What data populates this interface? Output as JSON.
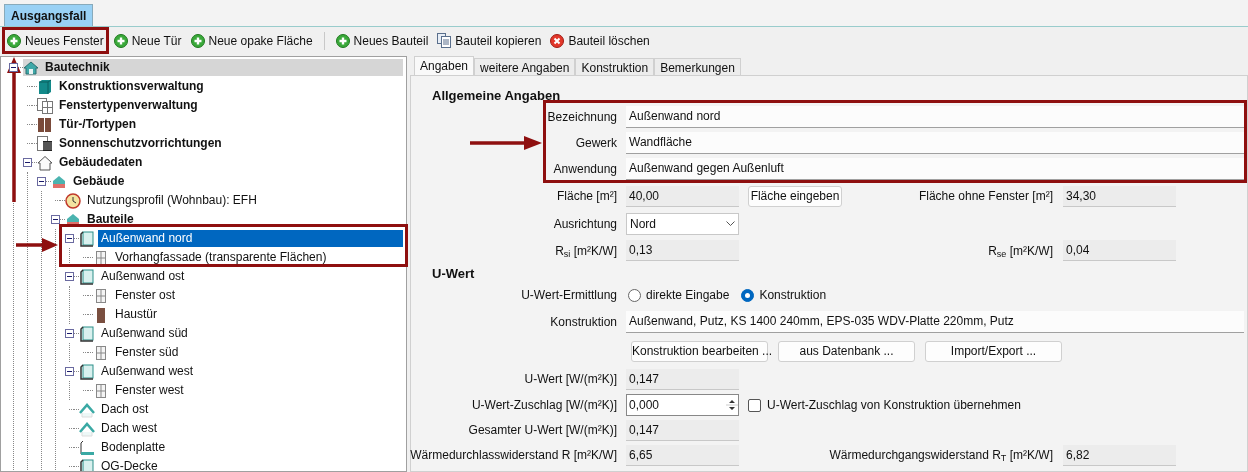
{
  "doc_tabs": [
    {
      "label": "Ausgangsfall",
      "selected": true
    }
  ],
  "toolbar": {
    "groups": [
      [
        {
          "label": "Neues Fenster",
          "kind": "add",
          "annotated": true
        },
        {
          "label": "Neue Tür",
          "kind": "add"
        },
        {
          "label": "Neue opake Fläche",
          "kind": "add"
        }
      ],
      [
        {
          "label": "Neues Bauteil",
          "kind": "add"
        },
        {
          "label": "Bauteil kopieren",
          "kind": "copy"
        },
        {
          "label": "Bauteil löschen",
          "kind": "delete"
        }
      ]
    ]
  },
  "tree": [
    {
      "label": "Bautechnik",
      "kind": "house",
      "bold": true,
      "selected": false,
      "expanded": true,
      "children": [
        {
          "label": "Konstruktionsverwaltung",
          "kind": "block",
          "bold": true,
          "selected": false
        },
        {
          "label": "Fenstertypenverwaltung",
          "kind": "window-type",
          "bold": true,
          "selected": false
        },
        {
          "label": "Tür-/Tortypen",
          "kind": "door-type",
          "bold": true,
          "selected": false
        },
        {
          "label": "Sonnenschutzvorrichtungen",
          "kind": "shade",
          "bold": true,
          "selected": false
        },
        {
          "label": "Gebäudedaten",
          "kind": "house-outline",
          "bold": true,
          "selected": false,
          "expanded": true,
          "children": [
            {
              "label": "Gebäude",
              "kind": "building",
              "bold": true,
              "selected": false,
              "expanded": true,
              "children": [
                {
                  "label": "Nutzungsprofil (Wohnbau): EFH",
                  "kind": "clock",
                  "bold": false,
                  "selected": false
                },
                {
                  "label": "Bauteile",
                  "kind": "building",
                  "bold": true,
                  "selected": false,
                  "expanded": true,
                  "children": [
                    {
                      "label": "Außenwand nord",
                      "kind": "wall",
                      "bold": false,
                      "selected": true,
                      "expanded": true,
                      "children": [
                        {
                          "label": "Vorhangfassade (transparente Flächen)",
                          "kind": "window",
                          "bold": false,
                          "selected": false
                        }
                      ]
                    },
                    {
                      "label": "Außenwand ost",
                      "kind": "wall",
                      "bold": false,
                      "selected": false,
                      "expanded": true,
                      "children": [
                        {
                          "label": "Fenster ost",
                          "kind": "window",
                          "bold": false,
                          "selected": false
                        },
                        {
                          "label": "Haustür",
                          "kind": "door",
                          "bold": false,
                          "selected": false
                        }
                      ]
                    },
                    {
                      "label": "Außenwand süd",
                      "kind": "wall",
                      "bold": false,
                      "selected": false,
                      "expanded": true,
                      "children": [
                        {
                          "label": "Fenster süd",
                          "kind": "window",
                          "bold": false,
                          "selected": false
                        }
                      ]
                    },
                    {
                      "label": "Außenwand west",
                      "kind": "wall",
                      "bold": false,
                      "selected": false,
                      "expanded": true,
                      "children": [
                        {
                          "label": "Fenster west",
                          "kind": "window",
                          "bold": false,
                          "selected": false
                        }
                      ]
                    },
                    {
                      "label": "Dach ost",
                      "kind": "roof",
                      "bold": false,
                      "selected": false
                    },
                    {
                      "label": "Dach west",
                      "kind": "roof",
                      "bold": false,
                      "selected": false
                    },
                    {
                      "label": "Bodenplatte",
                      "kind": "floor",
                      "bold": false,
                      "selected": false
                    },
                    {
                      "label": "OG-Decke",
                      "kind": "wall",
                      "bold": false,
                      "selected": false
                    }
                  ]
                }
              ]
            }
          ]
        }
      ]
    }
  ],
  "tabs": [
    {
      "label": "Angaben",
      "selected": true
    },
    {
      "label": "weitere Angaben",
      "selected": false
    },
    {
      "label": "Konstruktion",
      "selected": false
    },
    {
      "label": "Bemerkungen",
      "selected": false
    }
  ],
  "general": {
    "title": "Allgemeine Angaben",
    "bezeichnung": {
      "label": "Bezeichnung",
      "value": "Außenwand nord"
    },
    "gewerk": {
      "label": "Gewerk",
      "value": "Wandfläche"
    },
    "anwendung": {
      "label": "Anwendung",
      "value": "Außenwand gegen Außenluft"
    },
    "flaeche": {
      "label": "Fläche [m²]",
      "value": "40,00",
      "button": "Fläche eingeben"
    },
    "flaeche_ohne_fenster": {
      "label": "Fläche ohne Fenster [m²]",
      "value": "34,30"
    },
    "ausrichtung": {
      "label": "Ausrichtung",
      "value": "Nord"
    },
    "rsi": {
      "label": "R$_{si}$ [m²K/W]",
      "value": "0,13"
    },
    "rse": {
      "label": "R$_{se}$ [m²K/W]",
      "value": "0,04"
    }
  },
  "uwert": {
    "title": "U-Wert",
    "ermittlung": {
      "label": "U-Wert-Ermittlung",
      "options": [
        {
          "label": "direkte Eingabe",
          "selected": false
        },
        {
          "label": "Konstruktion",
          "selected": true
        }
      ]
    },
    "konstruktion": {
      "label": "Konstruktion",
      "value": "Außenwand, Putz, KS 1400 240mm, EPS-035 WDV-Platte 220mm, Putz"
    },
    "buttons": [
      "Konstruktion bearbeiten ...",
      "aus Datenbank ...",
      "Import/Export ..."
    ],
    "uwert": {
      "label": "U-Wert [W/(m²K)]",
      "value": "0,147"
    },
    "zuschlag": {
      "label": "U-Wert-Zuschlag [W/(m²K)]",
      "value": "0,000",
      "checkbox": {
        "label": "U-Wert-Zuschlag von Konstruktion übernehmen",
        "checked": false
      }
    },
    "gesamt": {
      "label": "Gesamter U-Wert [W/(m²K)]",
      "value": "0,147"
    },
    "r": {
      "label": "Wärmedurchlasswiderstand R [m²K/W]",
      "value": "6,65"
    },
    "rt": {
      "label": "Wärmedurchgangswiderstand R$_{T}$ [m²K/W]",
      "value": "6,82"
    }
  }
}
